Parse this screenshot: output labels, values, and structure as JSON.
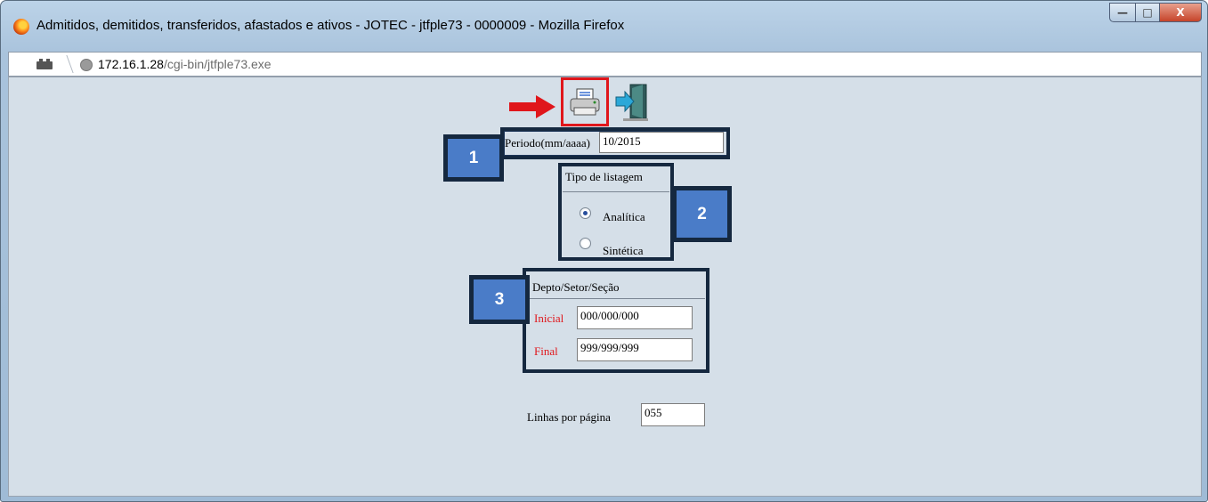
{
  "window": {
    "title": "Admitidos, demitidos, transferidos, afastados e ativos - JOTEC - jtfple73 - 0000009 - Mozilla Firefox",
    "controls": {
      "minimize": "—",
      "maximize": "□",
      "close": "X"
    }
  },
  "urlbar": {
    "host": "172.16.1.28",
    "path": "/cgi-bin/jtfple73.exe"
  },
  "toolbar": {
    "icons": [
      "print-icon",
      "exit-icon"
    ],
    "highlight_color": "#e0161b"
  },
  "periodo": {
    "label": "Periodo(mm/aaaa)",
    "value": "10/2015",
    "callout": "1"
  },
  "tipo_listagem": {
    "heading": "Tipo de listagem",
    "options": [
      {
        "label": "Analítica",
        "selected": true
      },
      {
        "label": "Sintética",
        "selected": false
      }
    ],
    "callout": "2"
  },
  "depto": {
    "heading": "Depto/Setor/Seção",
    "inicial_label": "Inicial",
    "inicial_value": "000/000/000",
    "final_label": "Final",
    "final_value": "999/999/999",
    "callout": "3"
  },
  "linhas": {
    "label": "Linhas por página",
    "value": "055"
  },
  "colors": {
    "callout_fill": "#4a7cc8",
    "callout_border": "#15283f",
    "content_bg": "#d5dfe8"
  }
}
